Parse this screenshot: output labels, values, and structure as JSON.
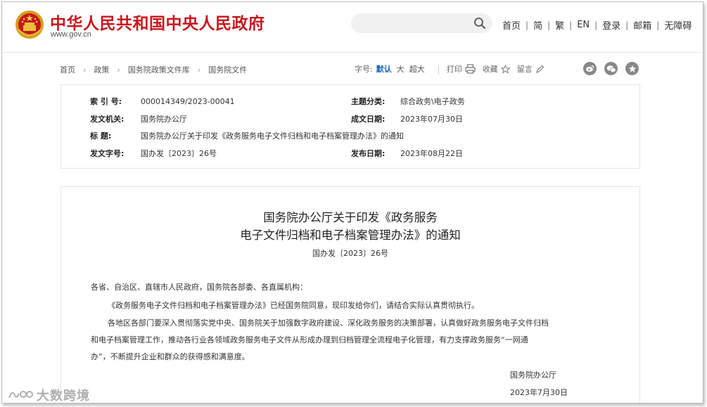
{
  "header": {
    "site_title": "中华人民共和国中央人民政府",
    "site_url": "www.gov.cn",
    "search_placeholder": "",
    "nav": [
      {
        "label": "首页"
      },
      {
        "label": "简"
      },
      {
        "label": "繁"
      },
      {
        "label": "EN"
      },
      {
        "label": "登录"
      },
      {
        "label": "邮箱"
      },
      {
        "label": "无障碍"
      }
    ],
    "brand_color": "#c8171d"
  },
  "breadcrumb": [
    "首页",
    "政策",
    "国务院政策文件库",
    "国务院文件"
  ],
  "toolbar": {
    "font_size_label": "字号:",
    "font_sizes": [
      "默认",
      "大",
      "超大"
    ],
    "selected_font_size": "默认",
    "print_label": "打印",
    "favorite_label": "收藏",
    "comment_label": "留言",
    "share_icons": [
      "weibo-icon",
      "wechat-icon",
      "star-icon"
    ]
  },
  "info": {
    "index_label": "索  引  号:",
    "index_value": "000014349/2023-00041",
    "issuer_label": "发文机关:",
    "issuer_value": "国务院办公厅",
    "title_label": "标      题:",
    "title_value": "国务院办公厅关于印发《政务服务电子文件归档和电子档案管理办法》的通知",
    "doc_no_label": "发文字号:",
    "doc_no_value": "国办发〔2023〕26号",
    "topic_label": "主题分类:",
    "topic_value": "综合政务\\电子政务",
    "written_label": "成文日期:",
    "written_value": "2023年07月30日",
    "published_label": "发布日期:",
    "published_value": "2023年08月22日"
  },
  "document": {
    "title_line1": "国务院办公厅关于印发《政务服务",
    "title_line2": "电子文件归档和电子档案管理办法》的通知",
    "doc_number": "国办发〔2023〕26号",
    "salutation": "各省、自治区、直辖市人民政府，国务院各部委、各直属机构：",
    "para1": "《政务服务电子文件归档和电子档案管理办法》已经国务院同意，现印发给你们，请结合实际认真贯彻执行。",
    "para2_line1": "各地区各部门要深入贯彻落实党中央、国务院关于加强数字政府建设、深化政务服务的决策部署，认真做好政务服务电子文件归档",
    "para2_line2": "和电子档案管理工作，推动各行业各领域政务服务电子文件从形成办理到归档管理全流程电子化管理，有力支撑政务服务“一网通",
    "para2_line3": "办”，不断提升企业和群众的获得感和满意度。",
    "signature": "国务院办公厅",
    "sign_date": "2023年7月30日"
  },
  "watermark": {
    "text": "大数跨境"
  }
}
